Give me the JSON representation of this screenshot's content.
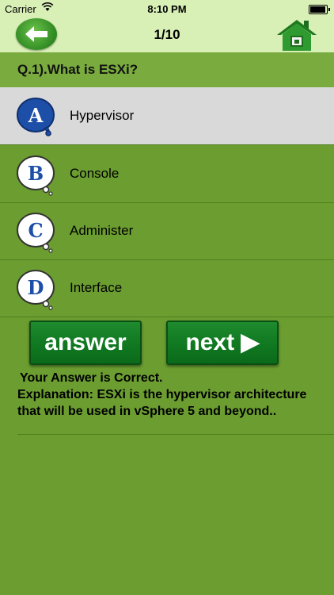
{
  "status": {
    "carrier": "Carrier",
    "time": "8:10 PM",
    "battery_level": 0.95
  },
  "nav": {
    "title": "1/10",
    "back_icon": "back-arrow-icon",
    "home_icon": "home-icon"
  },
  "question": {
    "text": "Q.1).What is ESXi?"
  },
  "options": [
    {
      "letter": "A",
      "label": "Hypervisor",
      "selected": true
    },
    {
      "letter": "B",
      "label": "Console",
      "selected": false
    },
    {
      "letter": "C",
      "label": "Administer",
      "selected": false
    },
    {
      "letter": "D",
      "label": "Interface",
      "selected": false
    }
  ],
  "actions": {
    "answer_label": "answer",
    "next_label": "next ▶"
  },
  "result": {
    "status": "Your Answer is Correct.",
    "explanation": "Explanation: ESXi is the hypervisor architecture that will be used in vSphere 5 and beyond.."
  },
  "colors": {
    "background": "#6b9d30",
    "navbar": "#d8efb6",
    "button_green": "#117a22",
    "letter_blue": "#1e4fa8"
  }
}
